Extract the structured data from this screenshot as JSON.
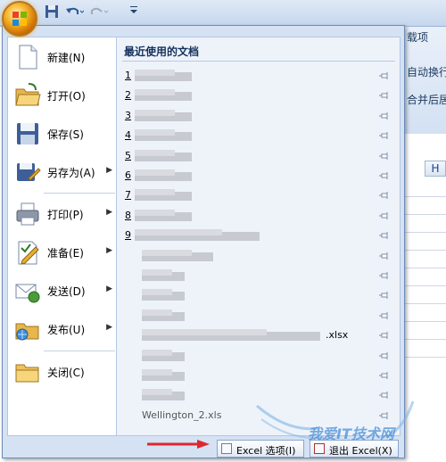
{
  "app": {
    "ribbon_tab_partial": "载项",
    "ribbon_wrap_partial": "自动换行",
    "ribbon_merge_partial": "合并后居",
    "column_header": "H"
  },
  "menu": {
    "items": [
      {
        "label": "新建(N)",
        "icon": "new-document-icon",
        "has_submenu": false
      },
      {
        "label": "打开(O)",
        "icon": "open-folder-icon",
        "has_submenu": false
      },
      {
        "label": "保存(S)",
        "icon": "save-disk-icon",
        "has_submenu": false
      },
      {
        "label": "另存为(A)",
        "icon": "save-as-icon",
        "has_submenu": true
      },
      {
        "label": "打印(P)",
        "icon": "printer-icon",
        "has_submenu": true
      },
      {
        "label": "准备(E)",
        "icon": "prepare-icon",
        "has_submenu": true
      },
      {
        "label": "发送(D)",
        "icon": "send-icon",
        "has_submenu": true
      },
      {
        "label": "发布(U)",
        "icon": "publish-icon",
        "has_submenu": true
      },
      {
        "label": "关闭(C)",
        "icon": "close-folder-icon",
        "has_submenu": false
      }
    ],
    "recent_title": "最近使用的文档",
    "recent": [
      {
        "num": "1",
        "suffix": ""
      },
      {
        "num": "2",
        "suffix": ""
      },
      {
        "num": "3",
        "suffix": ""
      },
      {
        "num": "4",
        "suffix": ""
      },
      {
        "num": "5",
        "suffix": ""
      },
      {
        "num": "6",
        "suffix": ""
      },
      {
        "num": "7",
        "suffix": ""
      },
      {
        "num": "8",
        "suffix": ""
      },
      {
        "num": "9",
        "suffix": ""
      },
      {
        "num": "",
        "suffix": ""
      },
      {
        "num": "",
        "suffix": ""
      },
      {
        "num": "",
        "suffix": ""
      },
      {
        "num": "",
        "suffix": ""
      },
      {
        "num": "",
        "suffix": ".xlsx"
      },
      {
        "num": "",
        "suffix": ""
      },
      {
        "num": "",
        "suffix": ""
      },
      {
        "num": "",
        "suffix": ""
      },
      {
        "num": "",
        "suffix": "Wellington_2.xls"
      }
    ],
    "options_button": "Excel 选项(I)",
    "exit_button": "退出 Excel(X)"
  },
  "watermark": {
    "text": "我爱IT技术网"
  },
  "colors": {
    "accent": "#15428b",
    "menu_bg": "#d4e2f4",
    "arrow": "#e0262d"
  }
}
